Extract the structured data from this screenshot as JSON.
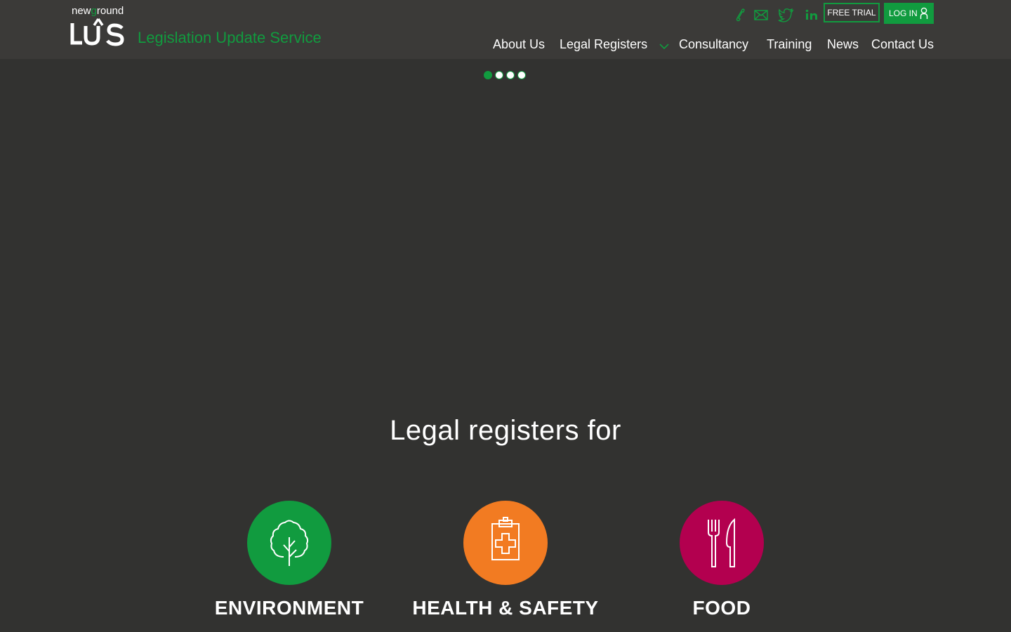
{
  "header": {
    "logo": {
      "brand_prefix": "new",
      "brand_g": "g",
      "brand_suffix": "round",
      "mark": "LUS"
    },
    "tagline": "Legislation Update Service",
    "contact_icons": [
      "phone-icon",
      "email-icon",
      "twitter-icon",
      "linkedin-icon"
    ],
    "free_trial_label": "FREE TRIAL",
    "login_label": "LOG IN"
  },
  "nav": {
    "items": [
      {
        "label": "About Us"
      },
      {
        "label": "Legal Registers",
        "dropdown": true
      },
      {
        "label": "Consultancy"
      },
      {
        "label": "Training"
      },
      {
        "label": "News"
      },
      {
        "label": "Contact Us"
      }
    ]
  },
  "slider": {
    "dot_count": 4,
    "active_index": 0
  },
  "hero": {
    "title": "Legal registers for",
    "categories": [
      {
        "label": "ENVIRONMENT",
        "icon": "tree-icon",
        "color": "#119b3f"
      },
      {
        "label": "HEALTH & SAFETY",
        "icon": "clipboard-cross-icon",
        "color": "#f27b22"
      },
      {
        "label": "FOOD",
        "icon": "fork-knife-icon",
        "color": "#b3004f"
      }
    ]
  },
  "colors": {
    "accent": "#119b3f",
    "header_bg": "#3b3a38",
    "page_bg": "#323230"
  }
}
